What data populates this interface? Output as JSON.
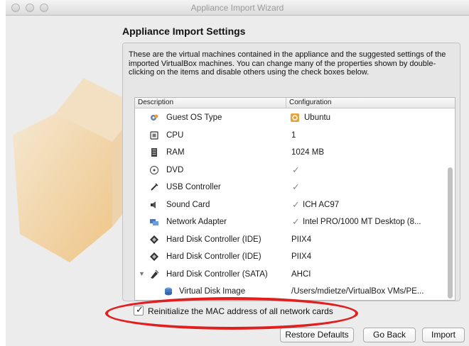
{
  "window": {
    "title": "Appliance Import Wizard"
  },
  "heading": "Appliance Import Settings",
  "description": "These are the virtual machines contained in the appliance and the suggested settings of the imported VirtualBox machines. You can change many of the properties shown by double-clicking on the items and disable others using the check boxes below.",
  "table": {
    "columns": [
      "Description",
      "Configuration"
    ],
    "rows": [
      {
        "icon": "gear-icon",
        "label": "Guest OS Type",
        "value": "Ubuntu",
        "value_icon": "ubuntu-icon"
      },
      {
        "icon": "cpu-icon",
        "label": "CPU",
        "value": "1"
      },
      {
        "icon": "ram-icon",
        "label": "RAM",
        "value": "1024 MB"
      },
      {
        "icon": "dvd-icon",
        "label": "DVD",
        "checked": true
      },
      {
        "icon": "usb-icon",
        "label": "USB Controller",
        "checked": true
      },
      {
        "icon": "sound-icon",
        "label": "Sound Card",
        "checked": true,
        "value": "ICH AC97"
      },
      {
        "icon": "network-icon",
        "label": "Network Adapter",
        "checked": true,
        "value": "Intel PRO/1000 MT Desktop (8..."
      },
      {
        "icon": "disk-controller-icon",
        "label": "Hard Disk Controller (IDE)",
        "value": "PIIX4"
      },
      {
        "icon": "disk-controller-icon",
        "label": "Hard Disk Controller (IDE)",
        "value": "PIIX4"
      },
      {
        "icon": "sata-controller-icon",
        "label": "Hard Disk Controller (SATA)",
        "value": "AHCI",
        "expanded": true
      },
      {
        "icon": "virtual-disk-icon",
        "label": "Virtual Disk Image",
        "value": "/Users/mdietze/VirtualBox VMs/PE..."
      }
    ]
  },
  "mac_option": {
    "label": "Reinitialize the MAC address of all network cards",
    "checked": true
  },
  "buttons": {
    "restore": "Restore Defaults",
    "back": "Go Back",
    "import": "Import"
  },
  "colors": {
    "annotation": "#e02020",
    "watermark": "#f2c27a"
  }
}
